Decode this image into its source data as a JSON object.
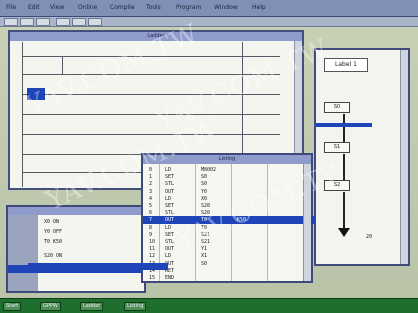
{
  "menubar": {
    "items": [
      "File",
      "Edit",
      "View",
      "Online",
      "Compile",
      "Tools",
      "Program",
      "Window",
      "Help"
    ]
  },
  "main_window": {
    "title": "Ladder"
  },
  "flow_window": {
    "label": "Label 1",
    "steps": [
      "S0",
      "S1",
      "S2"
    ],
    "end_label": "20"
  },
  "table_window": {
    "title": "Listing",
    "rows": [
      [
        "0",
        "LD",
        "M8002",
        ""
      ],
      [
        "1",
        "SET",
        "S0",
        ""
      ],
      [
        "2",
        "STL",
        "S0",
        ""
      ],
      [
        "3",
        "OUT",
        "Y0",
        ""
      ],
      [
        "4",
        "LD",
        "X0",
        ""
      ],
      [
        "5",
        "SET",
        "S20",
        ""
      ],
      [
        "6",
        "STL",
        "S20",
        ""
      ],
      [
        "7",
        "OUT",
        "T0",
        "K50"
      ],
      [
        "8",
        "LD",
        "T0",
        ""
      ],
      [
        "9",
        "SET",
        "S21",
        ""
      ],
      [
        "10",
        "STL",
        "S21",
        ""
      ],
      [
        "11",
        "OUT",
        "Y1",
        ""
      ],
      [
        "12",
        "LD",
        "X1",
        ""
      ],
      [
        "13",
        "OUT",
        "S0",
        ""
      ],
      [
        "14",
        "RET",
        "",
        ""
      ],
      [
        "15",
        "END",
        "",
        ""
      ]
    ]
  },
  "monitor_window": {
    "lines": [
      "X0  ON",
      "Y0  OFF",
      "T0  K50",
      "S20 ON"
    ]
  },
  "taskbar": {
    "items": [
      "Start",
      "GPPW",
      "Ladder",
      "Listing"
    ]
  },
  "watermark": "YAV.COM.TW",
  "colors": {
    "selection": "#1f44b8",
    "title_bar": "#8f9ccb",
    "taskbar": "#1e6f2e"
  }
}
